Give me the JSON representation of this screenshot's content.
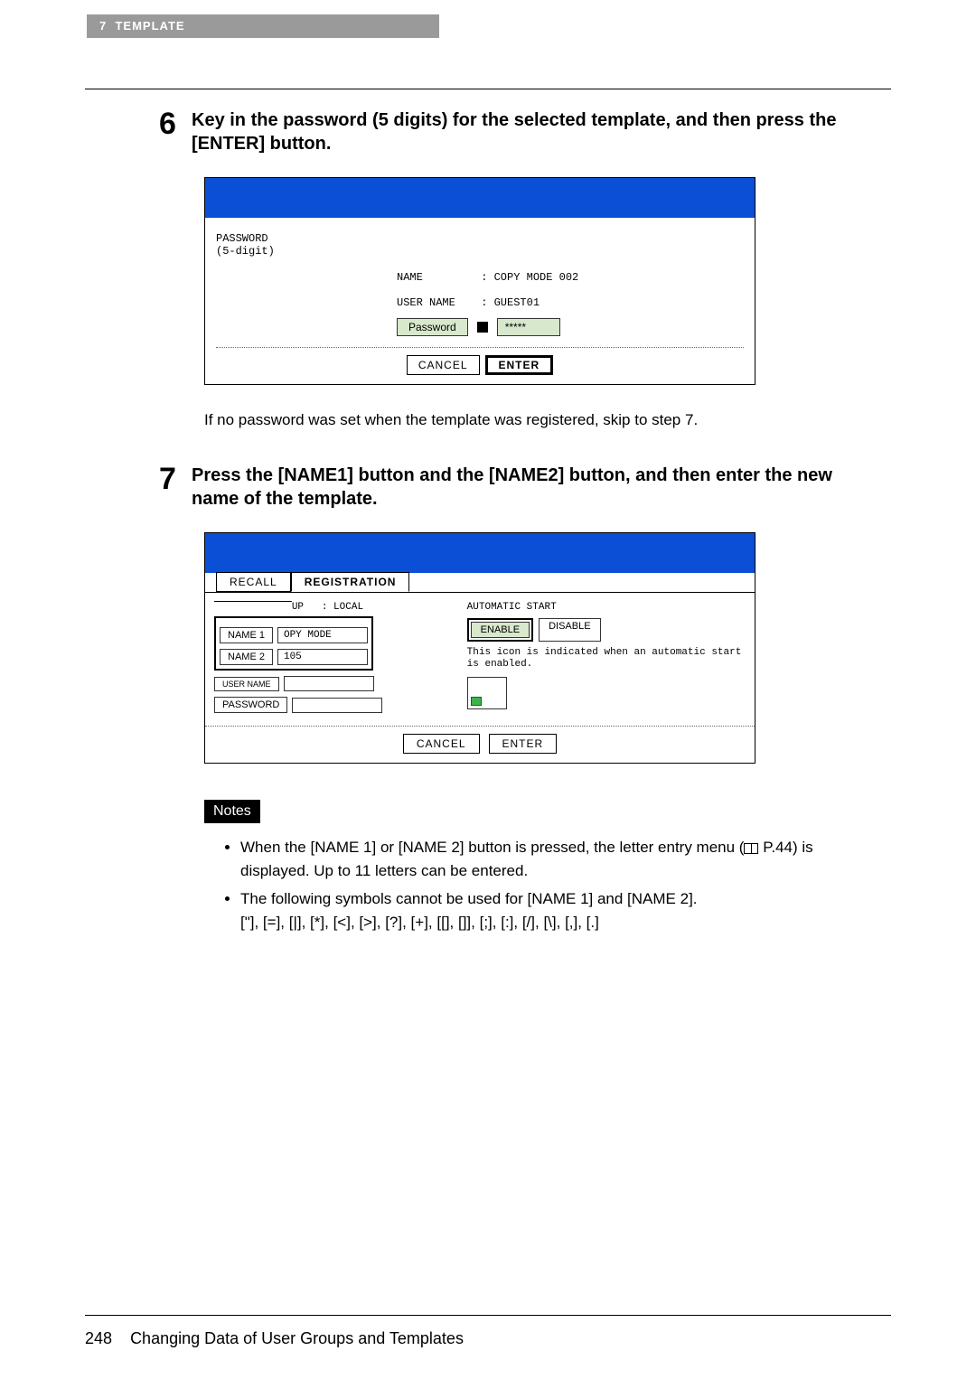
{
  "header": {
    "chapter": "7",
    "title": "TEMPLATE"
  },
  "step6": {
    "num": "6",
    "text": "Key in the password (5 digits) for the selected template, and then press the [ENTER] button.",
    "screen": {
      "pw_label_1": "PASSWORD",
      "pw_label_2": "(5-digit)",
      "name_label": "NAME",
      "name_value": ": COPY MODE 002",
      "user_label": "USER NAME",
      "user_value": ": GUEST01",
      "pw_btn": "Password",
      "pw_field": "*****",
      "cancel": "CANCEL",
      "enter": "ENTER"
    },
    "caption": "If no password was set when the template was registered, skip to step 7."
  },
  "step7": {
    "num": "7",
    "text": "Press the [NAME1] button and the [NAME2] button, and then enter the new name of the template.",
    "screen": {
      "tab_recall": "RECALL",
      "tab_reg": "REGISTRATION",
      "grp_suffix": "UP",
      "grp_val": ": LOCAL",
      "name1_btn": "NAME 1",
      "name1_val": "OPY MODE",
      "name2_btn": "NAME 2",
      "name2_val": "105",
      "user_btn": "USER NAME",
      "pwd_btn": "PASSWORD",
      "auto_label": "AUTOMATIC START",
      "enable": "ENABLE",
      "disable": "DISABLE",
      "icon_note": "This icon is indicated when an automatic start is enabled.",
      "cancel": "CANCEL",
      "enter": "ENTER"
    }
  },
  "notes": {
    "label": "Notes",
    "item1a": "When the [NAME 1] or [NAME 2] button is pressed, the letter entry menu (",
    "item1b": " P.44) is displayed. Up to 11 letters can be entered.",
    "item2a": "The following symbols cannot be used for [NAME 1] and [NAME 2].",
    "item2b": "[\"], [=], [|], [*], [<], [>], [?], [+], [[], []], [;], [:], [/], [\\], [,], [.]"
  },
  "footer": {
    "page": "248",
    "section": "Changing Data of User Groups and Templates"
  }
}
